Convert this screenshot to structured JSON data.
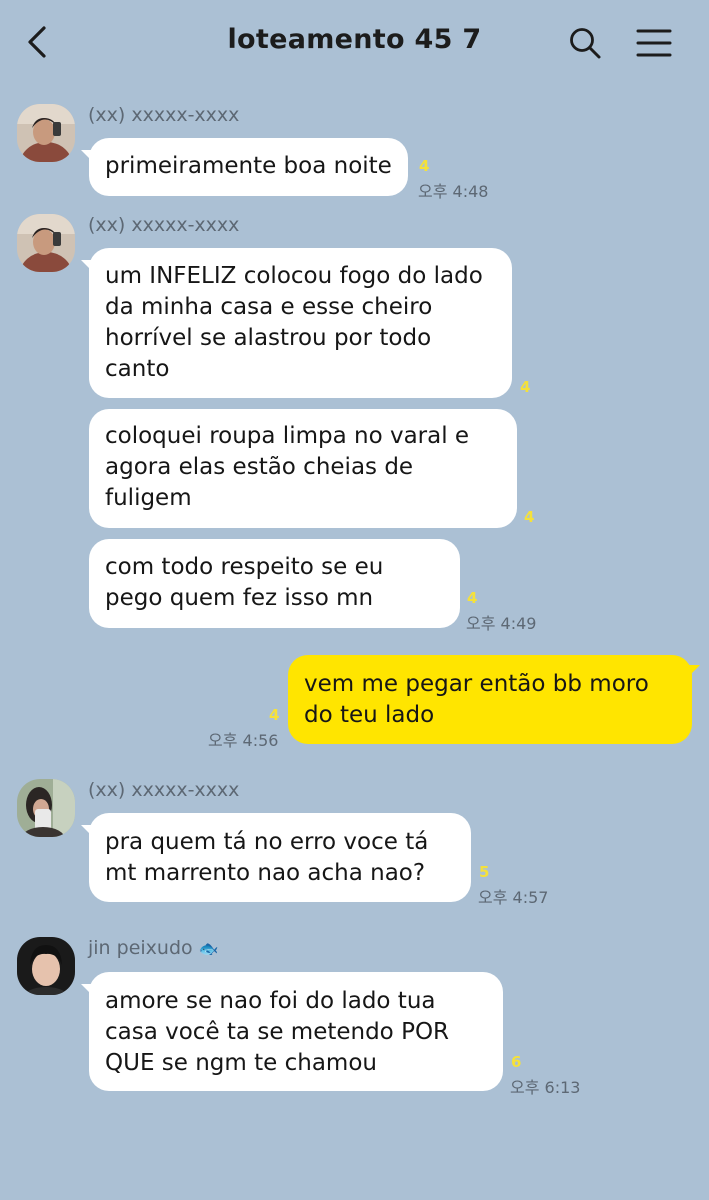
{
  "header": {
    "title": "loteamento 45 7"
  },
  "messages": [
    {
      "sender": "(xx) xxxxx-xxxx",
      "text": "primeiramente boa noite",
      "unread": "4",
      "time": "오후 4:48"
    },
    {
      "sender": "(xx) xxxxx-xxxx",
      "text": "um INFELIZ colocou fogo do lado da minha casa e esse cheiro horrível se alastrou por todo canto",
      "unread": "4"
    },
    {
      "text": "coloquei roupa limpa no varal e agora elas estão cheias de fuligem",
      "unread": "4"
    },
    {
      "text": "com todo respeito se eu pego quem fez isso mn",
      "unread": "4",
      "time": "오후 4:49"
    },
    {
      "text": "vem me pegar então bb moro do teu lado",
      "unread": "4",
      "time": "오후 4:56"
    },
    {
      "sender": "(xx) xxxxx-xxxx",
      "text": "pra quem tá no erro voce tá mt marrento nao acha nao?",
      "unread": "5",
      "time": "오후 4:57"
    },
    {
      "sender": "jin peixudo",
      "sender_emoji": "🐟",
      "text": "amore se nao foi do lado tua casa você ta se metendo POR QUE se ngm te chamou",
      "unread": "6",
      "time": "오후 6:13"
    }
  ],
  "colors": {
    "background": "#abc0d4",
    "incoming": "#ffffff",
    "outgoing": "#ffe500",
    "unread": "#f5e13a"
  }
}
